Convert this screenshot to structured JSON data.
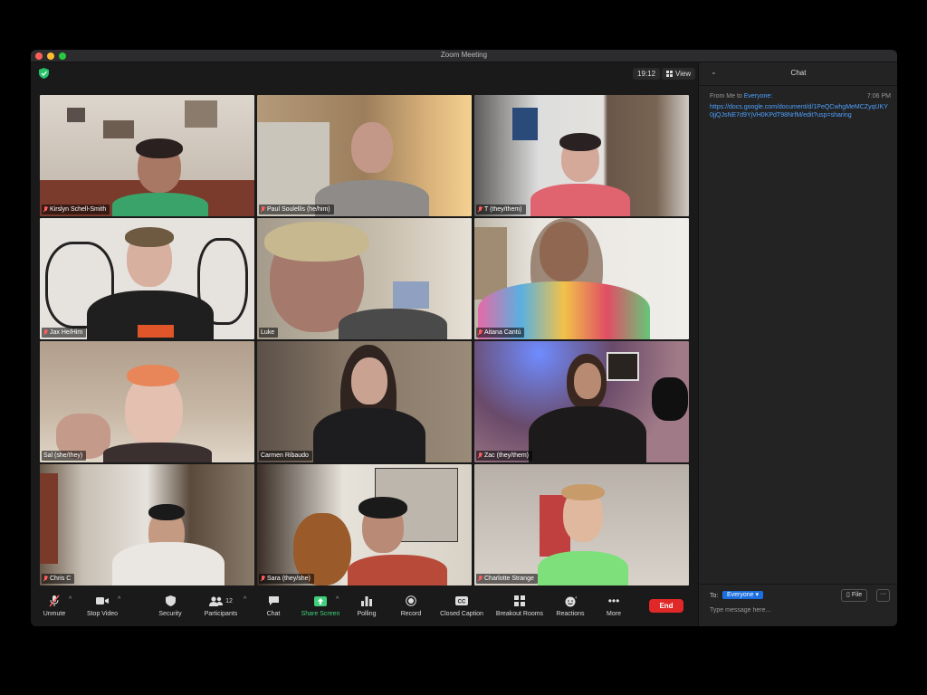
{
  "window": {
    "title": "Zoom Meeting"
  },
  "top": {
    "timer": "19:12",
    "view_label": "View"
  },
  "participants": [
    {
      "name": "Kirslyn Schell-Smith",
      "muted": true
    },
    {
      "name": "Paul Soulellis (he/him)",
      "muted": true
    },
    {
      "name": "T (they/them)",
      "muted": true
    },
    {
      "name": "Jax He/Him",
      "muted": true
    },
    {
      "name": "Luke",
      "muted": false,
      "active_speaker": true
    },
    {
      "name": "Aitana Cantú",
      "muted": true
    },
    {
      "name": "Sal (she/they)",
      "muted": false
    },
    {
      "name": "Carmen Ribaudo",
      "muted": false
    },
    {
      "name": "Zac (they/them)",
      "muted": true
    },
    {
      "name": "Chris C",
      "muted": true
    },
    {
      "name": "Sara (they/she)",
      "muted": true
    },
    {
      "name": "Charlotte Strange",
      "muted": true
    }
  ],
  "toolbar": {
    "unmute": "Unmute",
    "stop_video": "Stop Video",
    "security": "Security",
    "participants": "Participants",
    "participant_count": "12",
    "chat": "Chat",
    "share_screen": "Share Screen",
    "polling": "Polling",
    "record": "Record",
    "closed_caption": "Closed Caption",
    "breakout_rooms": "Breakout Rooms",
    "reactions": "Reactions",
    "more": "More",
    "end": "End"
  },
  "chat": {
    "title": "Chat",
    "message": {
      "from": "From Me to",
      "to": "Everyone:",
      "time": "7:06 PM",
      "link": "https://docs.google.com/document/d/1PeQCwhgMeMCZyqUKY0jjQJsNE7d9YjVH0KPdT98NrfM/edit?usp=sharing"
    },
    "to_label": "To:",
    "to_value": "Everyone",
    "file_label": "File",
    "more_label": "···",
    "input_placeholder": "Type message here..."
  },
  "colors": {
    "accent_blue": "#1b6fe0",
    "link_blue": "#4ea0ff",
    "end_red": "#e02828",
    "share_green": "#3fd07a",
    "active_speaker": "#e6e37a",
    "muted_red": "#ff5e5e"
  }
}
